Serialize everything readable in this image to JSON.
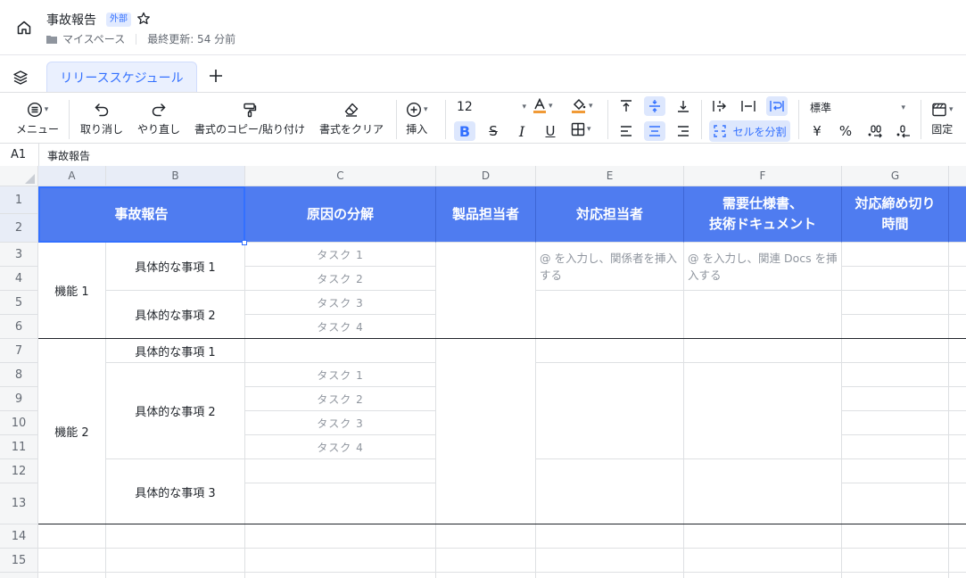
{
  "header": {
    "title": "事故報告",
    "badge": "外部",
    "location": "マイスペース",
    "updated": "最終更新: 54 分前"
  },
  "tabs": {
    "active": "リリーススケジュール"
  },
  "toolbar": {
    "menu": "メニュー",
    "undo": "取り消し",
    "redo": "やり直し",
    "format_painter": "書式のコピー/貼り付け",
    "clear_format": "書式をクリア",
    "insert": "挿入",
    "font_size": "12",
    "split_cells": "セルを分割",
    "number_format": "標準",
    "freeze": "固定",
    "accent_color": "#3370ff"
  },
  "formula_bar": {
    "cell_ref": "A1",
    "value": "事故報告"
  },
  "grid": {
    "columns": [
      "A",
      "B",
      "C",
      "D",
      "E",
      "F",
      "G"
    ],
    "rows": [
      "1",
      "2",
      "3",
      "4",
      "5",
      "6",
      "7",
      "8",
      "9",
      "10",
      "11",
      "12",
      "13",
      "14",
      "15"
    ],
    "header_color": "#4f7cf0",
    "headers": {
      "a_b": "事故報告",
      "c": "原因の分解",
      "d": "製品担当者",
      "e": "対応担当者",
      "f_line1": "需要仕様書、",
      "f_line2": "技術ドキュメント",
      "g_line1": "対応締め切り",
      "g_line2": "時間"
    },
    "feature1": "機能 1",
    "feature2": "機能 2",
    "item1": "具体的な事項 1",
    "item2": "具体的な事項 2",
    "item3": "具体的な事項 3",
    "task1": "タスク 1",
    "task2": "タスク 2",
    "task3": "タスク 3",
    "task4": "タスク 4",
    "e_placeholder": "@ を入力し、関係者を挿入する",
    "f_placeholder": "@ を入力し、関連 Docs を挿入する"
  }
}
